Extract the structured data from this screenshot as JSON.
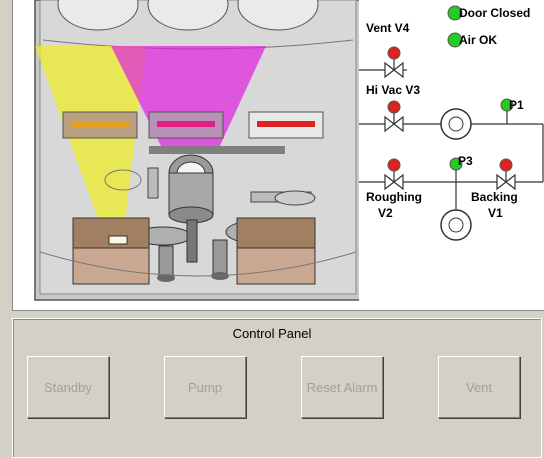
{
  "indicators": {
    "door_closed": {
      "label": "Door Closed",
      "state": "green"
    },
    "air_ok": {
      "label": "Air OK",
      "state": "green"
    }
  },
  "valves": {
    "vent_v4": {
      "label": "Vent V4",
      "state": "red"
    },
    "hi_vac_v3": {
      "label": "Hi Vac V3",
      "state": "red"
    },
    "roughing_v2": {
      "label_line1": "Roughing",
      "label_line2": "V2",
      "state": "red"
    },
    "backing_v1": {
      "label_line1": "Backing",
      "label_line2": "V1",
      "state": "red"
    }
  },
  "gauges": {
    "p1": {
      "label": "P1",
      "state": "green"
    },
    "p3": {
      "label": "P3",
      "state": "green"
    }
  },
  "colors": {
    "green_led": "#22cc22",
    "red_led": "#dd2222",
    "yellow_beam": "#f0f020",
    "magenta_beam": "#e020e0",
    "chamber_gray": "#c8c8c8"
  },
  "control_panel": {
    "title": "Control Panel",
    "buttons": {
      "standby": "Standby",
      "pump": "Pump",
      "reset_alarm": "Reset Alarm",
      "vent": "Vent"
    },
    "enabled": false
  }
}
